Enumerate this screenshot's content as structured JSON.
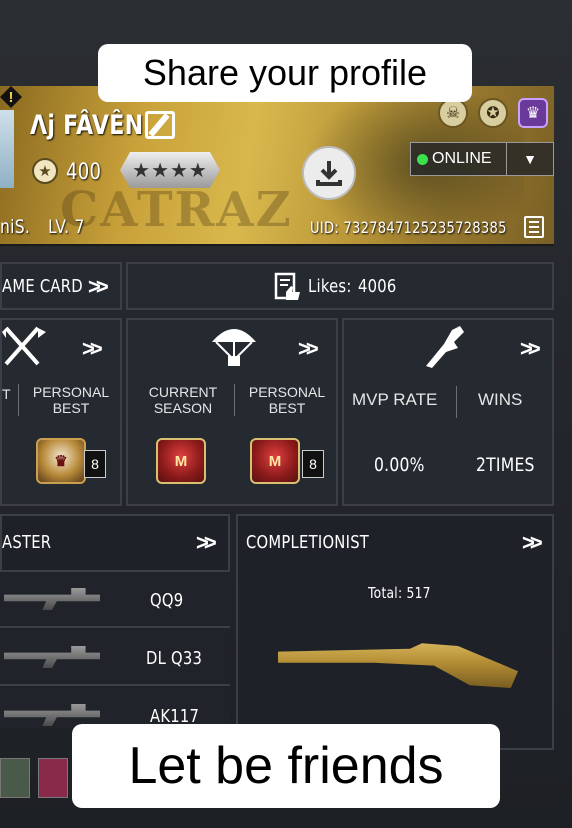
{
  "overlays": {
    "top_caption": "Share your profile",
    "bottom_caption": "Let be friends"
  },
  "profile": {
    "name": "Λj FÂVÊN",
    "points": "400",
    "rank_stars": "★★★★",
    "banner_text": "CATRAZ",
    "tag": "niS.",
    "level": "LV. 7",
    "status": "ONLINE",
    "uid": "UID: 7327847125235728385",
    "status_color": "#3be04a"
  },
  "row1": {
    "game_card_label": "AME CARD",
    "likes_label": "Likes:",
    "likes_value": "4006"
  },
  "stats": {
    "panel1": {
      "left_label": "T",
      "personal_best": "PERSONAL BEST",
      "tier": "8"
    },
    "panel2": {
      "current_season": "CURRENT SEASON",
      "personal_best": "PERSONAL BEST",
      "tier": "8"
    },
    "panel3": {
      "mvp_label": "MVP RATE",
      "wins_label": "WINS",
      "mvp_value": "0.00%",
      "wins_value": "2TIMES"
    }
  },
  "master": {
    "title": "ASTER",
    "weapons": [
      "QQ9",
      "DL Q33",
      "AK117"
    ]
  },
  "completionist": {
    "title": "COMPLETIONIST",
    "total": "Total: 517"
  },
  "icons": {
    "download": "download-icon",
    "edit": "edit-icon",
    "copy": "copy-icon",
    "chevrons": "double-chevron-icon"
  }
}
